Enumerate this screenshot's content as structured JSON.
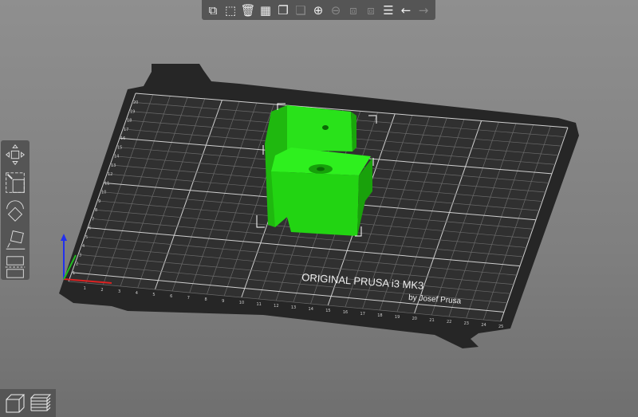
{
  "toolbar": {
    "items": [
      {
        "name": "add",
        "icon": "add-object-icon",
        "enabled": true
      },
      {
        "name": "delete",
        "icon": "delete-object-icon",
        "enabled": true
      },
      {
        "name": "delete_all",
        "icon": "trash-icon",
        "enabled": true
      },
      {
        "name": "arrange",
        "icon": "arrange-icon",
        "enabled": true
      },
      {
        "name": "copy",
        "icon": "copy-icon",
        "enabled": true
      },
      {
        "name": "paste",
        "icon": "paste-icon",
        "enabled": false
      },
      {
        "name": "add_instance",
        "icon": "plus-circle-icon",
        "enabled": true
      },
      {
        "name": "remove_instance",
        "icon": "minus-circle-icon",
        "enabled": false
      },
      {
        "name": "split_objects",
        "icon": "split-objects-icon",
        "enabled": false
      },
      {
        "name": "split_parts",
        "icon": "split-parts-icon",
        "enabled": false
      },
      {
        "name": "layers",
        "icon": "layers-editing-icon",
        "enabled": true
      },
      {
        "name": "undo",
        "icon": "undo-arrow-icon",
        "enabled": true
      },
      {
        "name": "redo",
        "icon": "redo-arrow-icon",
        "enabled": false
      }
    ]
  },
  "sidebar": {
    "tools": [
      "move",
      "scale",
      "rotate",
      "place-on-face",
      "cut"
    ]
  },
  "bed": {
    "title": "ORIGINAL PRUSA i3  MK3",
    "subtitle": "by Josef Prusa",
    "x_labels": [
      "1",
      "2",
      "3",
      "4",
      "5",
      "6",
      "7",
      "8",
      "9",
      "10",
      "11",
      "12",
      "13",
      "14",
      "15",
      "16",
      "17",
      "18",
      "19",
      "20",
      "21",
      "22",
      "23",
      "24",
      "25"
    ],
    "y_labels": [
      "1",
      "2",
      "3",
      "4",
      "5",
      "6",
      "7",
      "8",
      "9",
      "10",
      "11",
      "12",
      "13",
      "14",
      "15",
      "16",
      "17",
      "18",
      "19",
      "20"
    ]
  },
  "colors": {
    "object": "#22dd11",
    "bed": "#2a2a2a",
    "panel": "#555555"
  },
  "view": {
    "buttons": [
      "3d-view",
      "preview"
    ]
  }
}
